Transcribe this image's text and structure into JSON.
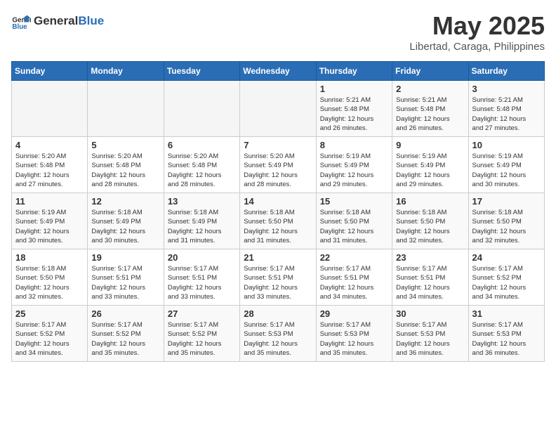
{
  "header": {
    "logo_general": "General",
    "logo_blue": "Blue",
    "month": "May 2025",
    "location": "Libertad, Caraga, Philippines"
  },
  "days_of_week": [
    "Sunday",
    "Monday",
    "Tuesday",
    "Wednesday",
    "Thursday",
    "Friday",
    "Saturday"
  ],
  "weeks": [
    [
      {
        "day": "",
        "info": ""
      },
      {
        "day": "",
        "info": ""
      },
      {
        "day": "",
        "info": ""
      },
      {
        "day": "",
        "info": ""
      },
      {
        "day": "1",
        "info": "Sunrise: 5:21 AM\nSunset: 5:48 PM\nDaylight: 12 hours\nand 26 minutes."
      },
      {
        "day": "2",
        "info": "Sunrise: 5:21 AM\nSunset: 5:48 PM\nDaylight: 12 hours\nand 26 minutes."
      },
      {
        "day": "3",
        "info": "Sunrise: 5:21 AM\nSunset: 5:48 PM\nDaylight: 12 hours\nand 27 minutes."
      }
    ],
    [
      {
        "day": "4",
        "info": "Sunrise: 5:20 AM\nSunset: 5:48 PM\nDaylight: 12 hours\nand 27 minutes."
      },
      {
        "day": "5",
        "info": "Sunrise: 5:20 AM\nSunset: 5:48 PM\nDaylight: 12 hours\nand 28 minutes."
      },
      {
        "day": "6",
        "info": "Sunrise: 5:20 AM\nSunset: 5:48 PM\nDaylight: 12 hours\nand 28 minutes."
      },
      {
        "day": "7",
        "info": "Sunrise: 5:20 AM\nSunset: 5:49 PM\nDaylight: 12 hours\nand 28 minutes."
      },
      {
        "day": "8",
        "info": "Sunrise: 5:19 AM\nSunset: 5:49 PM\nDaylight: 12 hours\nand 29 minutes."
      },
      {
        "day": "9",
        "info": "Sunrise: 5:19 AM\nSunset: 5:49 PM\nDaylight: 12 hours\nand 29 minutes."
      },
      {
        "day": "10",
        "info": "Sunrise: 5:19 AM\nSunset: 5:49 PM\nDaylight: 12 hours\nand 30 minutes."
      }
    ],
    [
      {
        "day": "11",
        "info": "Sunrise: 5:19 AM\nSunset: 5:49 PM\nDaylight: 12 hours\nand 30 minutes."
      },
      {
        "day": "12",
        "info": "Sunrise: 5:18 AM\nSunset: 5:49 PM\nDaylight: 12 hours\nand 30 minutes."
      },
      {
        "day": "13",
        "info": "Sunrise: 5:18 AM\nSunset: 5:49 PM\nDaylight: 12 hours\nand 31 minutes."
      },
      {
        "day": "14",
        "info": "Sunrise: 5:18 AM\nSunset: 5:50 PM\nDaylight: 12 hours\nand 31 minutes."
      },
      {
        "day": "15",
        "info": "Sunrise: 5:18 AM\nSunset: 5:50 PM\nDaylight: 12 hours\nand 31 minutes."
      },
      {
        "day": "16",
        "info": "Sunrise: 5:18 AM\nSunset: 5:50 PM\nDaylight: 12 hours\nand 32 minutes."
      },
      {
        "day": "17",
        "info": "Sunrise: 5:18 AM\nSunset: 5:50 PM\nDaylight: 12 hours\nand 32 minutes."
      }
    ],
    [
      {
        "day": "18",
        "info": "Sunrise: 5:18 AM\nSunset: 5:50 PM\nDaylight: 12 hours\nand 32 minutes."
      },
      {
        "day": "19",
        "info": "Sunrise: 5:17 AM\nSunset: 5:51 PM\nDaylight: 12 hours\nand 33 minutes."
      },
      {
        "day": "20",
        "info": "Sunrise: 5:17 AM\nSunset: 5:51 PM\nDaylight: 12 hours\nand 33 minutes."
      },
      {
        "day": "21",
        "info": "Sunrise: 5:17 AM\nSunset: 5:51 PM\nDaylight: 12 hours\nand 33 minutes."
      },
      {
        "day": "22",
        "info": "Sunrise: 5:17 AM\nSunset: 5:51 PM\nDaylight: 12 hours\nand 34 minutes."
      },
      {
        "day": "23",
        "info": "Sunrise: 5:17 AM\nSunset: 5:51 PM\nDaylight: 12 hours\nand 34 minutes."
      },
      {
        "day": "24",
        "info": "Sunrise: 5:17 AM\nSunset: 5:52 PM\nDaylight: 12 hours\nand 34 minutes."
      }
    ],
    [
      {
        "day": "25",
        "info": "Sunrise: 5:17 AM\nSunset: 5:52 PM\nDaylight: 12 hours\nand 34 minutes."
      },
      {
        "day": "26",
        "info": "Sunrise: 5:17 AM\nSunset: 5:52 PM\nDaylight: 12 hours\nand 35 minutes."
      },
      {
        "day": "27",
        "info": "Sunrise: 5:17 AM\nSunset: 5:52 PM\nDaylight: 12 hours\nand 35 minutes."
      },
      {
        "day": "28",
        "info": "Sunrise: 5:17 AM\nSunset: 5:53 PM\nDaylight: 12 hours\nand 35 minutes."
      },
      {
        "day": "29",
        "info": "Sunrise: 5:17 AM\nSunset: 5:53 PM\nDaylight: 12 hours\nand 35 minutes."
      },
      {
        "day": "30",
        "info": "Sunrise: 5:17 AM\nSunset: 5:53 PM\nDaylight: 12 hours\nand 36 minutes."
      },
      {
        "day": "31",
        "info": "Sunrise: 5:17 AM\nSunset: 5:53 PM\nDaylight: 12 hours\nand 36 minutes."
      }
    ]
  ]
}
